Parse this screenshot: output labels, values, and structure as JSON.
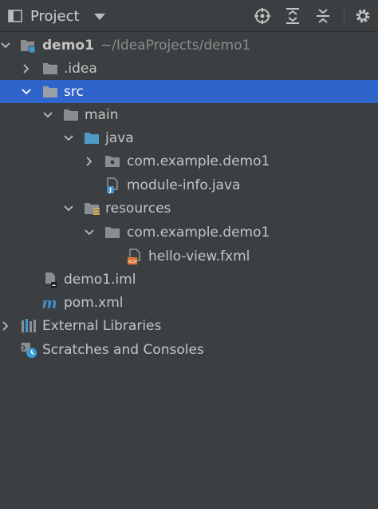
{
  "header": {
    "title": "Project",
    "tools": [
      "locate-icon",
      "expand-all-icon",
      "collapse-all-icon",
      "gear-icon"
    ]
  },
  "tree": {
    "root": {
      "label": "demo1",
      "path": "~/IdeaProjects/demo1"
    },
    "idea": {
      "label": ".idea"
    },
    "src": {
      "label": "src"
    },
    "main": {
      "label": "main"
    },
    "java": {
      "label": "java"
    },
    "package1": {
      "label": "com.example.demo1"
    },
    "module_info": {
      "label": "module-info.java"
    },
    "resources": {
      "label": "resources"
    },
    "package2": {
      "label": "com.example.demo1"
    },
    "hello_view": {
      "label": "hello-view.fxml"
    },
    "iml": {
      "label": "demo1.iml"
    },
    "pom": {
      "label": "pom.xml"
    },
    "ext_libs": {
      "label": "External Libraries"
    },
    "scratches": {
      "label": "Scratches and Consoles"
    }
  },
  "colors": {
    "background": "#3c3f41",
    "selection": "#2f65ca",
    "folder": "#8b8e91",
    "source_folder": "#4f9bc4",
    "path_text": "#8c8c8c"
  }
}
